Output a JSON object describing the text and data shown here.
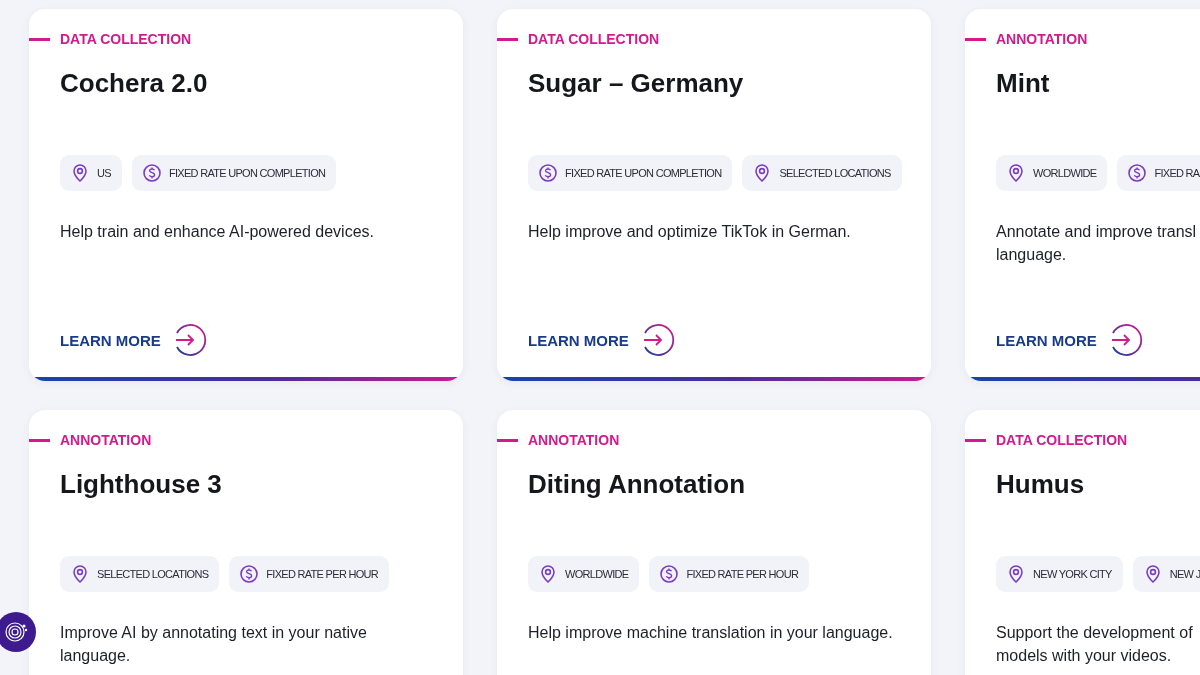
{
  "cards": [
    {
      "category": "DATA COLLECTION",
      "title": "Cochera 2.0",
      "tags": [
        {
          "kind": "location",
          "label": "US"
        },
        {
          "kind": "rate",
          "label": "FIXED RATE UPON COMPLETION"
        }
      ],
      "description_lines": [
        "Help train and enhance AI-powered devices."
      ],
      "link": "LEARN MORE"
    },
    {
      "category": "DATA COLLECTION",
      "title": "Sugar – Germany",
      "tags": [
        {
          "kind": "rate",
          "label": "FIXED RATE UPON COMPLETION"
        },
        {
          "kind": "location",
          "label": "SELECTED LOCATIONS"
        }
      ],
      "description_lines": [
        "Help improve and optimize TikTok in German."
      ],
      "link": "LEARN MORE"
    },
    {
      "category": "ANNOTATION",
      "title": "Mint",
      "tags": [
        {
          "kind": "location",
          "label": "WORLDWIDE"
        },
        {
          "kind": "rate",
          "label": "FIXED RA"
        }
      ],
      "description_lines": [
        "Annotate and improve transl",
        "language."
      ],
      "link": "LEARN MORE"
    },
    {
      "category": "ANNOTATION",
      "title": "Lighthouse 3",
      "tags": [
        {
          "kind": "location",
          "label": "SELECTED LOCATIONS"
        },
        {
          "kind": "rate",
          "label": "FIXED RATE PER HOUR"
        }
      ],
      "description_lines": [
        "Improve AI by annotating text in your native",
        "language."
      ]
    },
    {
      "category": "ANNOTATION",
      "title": "Diting Annotation",
      "tags": [
        {
          "kind": "location",
          "label": "WORLDWIDE"
        },
        {
          "kind": "rate",
          "label": "FIXED RATE PER HOUR"
        }
      ],
      "description_lines": [
        "Help improve machine translation in your language."
      ]
    },
    {
      "category": "DATA COLLECTION",
      "title": "Humus",
      "tags": [
        {
          "kind": "location",
          "label": "NEW YORK CITY"
        },
        {
          "kind": "location",
          "label": "NEW J"
        }
      ],
      "description_lines": [
        "Support the development of",
        "models with your videos."
      ]
    }
  ]
}
